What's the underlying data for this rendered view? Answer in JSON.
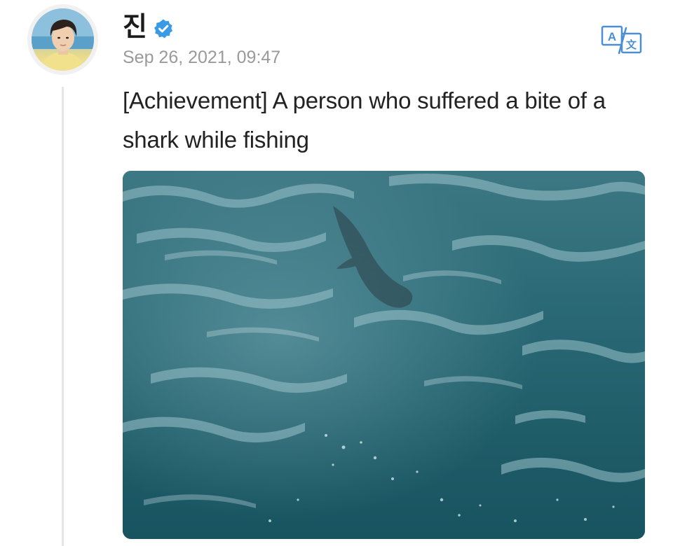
{
  "post": {
    "author_name": "진",
    "verified": true,
    "date": "Sep 26, 2021, 09:47",
    "text": "[Achievement] A person who suffered a bite of a shark while fishing",
    "media": {
      "type": "video-still",
      "description_icon": "ocean-video"
    }
  },
  "icons": {
    "verified": "verified-badge-icon",
    "translate": "translate-icon"
  },
  "colors": {
    "verified_blue": "#3b9ae6",
    "translate_blue": "#4a8fd4",
    "date_gray": "#9a9a9a",
    "thread_line": "#e6e6e6",
    "water_dark": "#1f5b67",
    "water_light": "#6fa0ab"
  }
}
